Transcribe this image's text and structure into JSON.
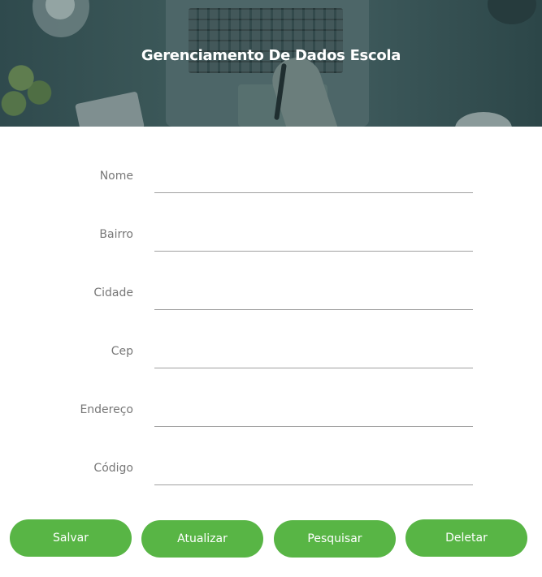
{
  "header": {
    "title": "Gerenciamento De Dados Escola"
  },
  "form": {
    "fields": [
      {
        "label": "Nome",
        "value": ""
      },
      {
        "label": "Bairro",
        "value": ""
      },
      {
        "label": "Cidade",
        "value": ""
      },
      {
        "label": "Cep",
        "value": ""
      },
      {
        "label": "Endereço",
        "value": ""
      },
      {
        "label": "Código",
        "value": ""
      }
    ]
  },
  "actions": {
    "save_label": "Salvar",
    "update_label": "Atualizar",
    "search_label": "Pesquisar",
    "delete_label": "Deletar"
  },
  "colors": {
    "button_green": "#58b545",
    "label_gray": "#777777",
    "header_overlay": "#3b5758"
  }
}
